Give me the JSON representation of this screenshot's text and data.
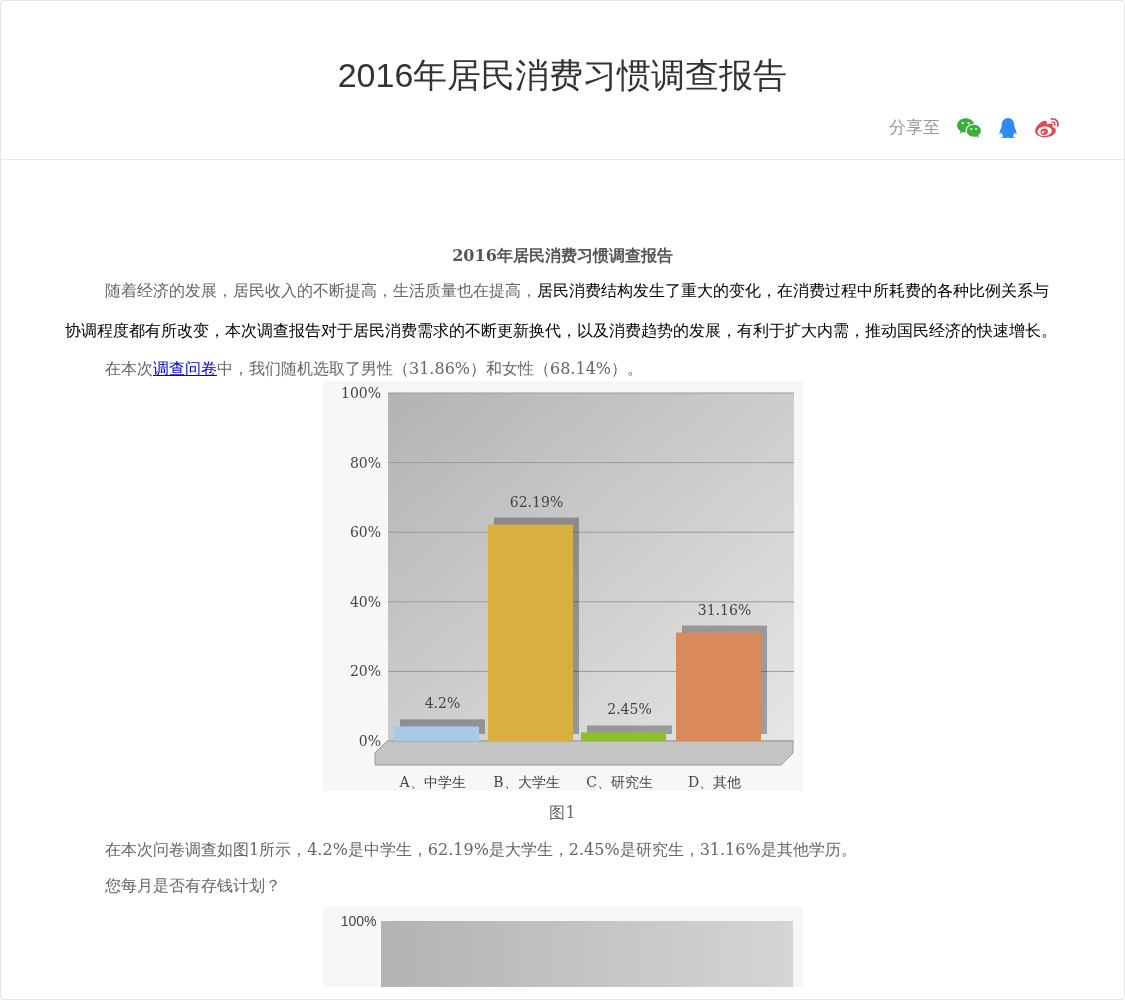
{
  "page_title": "2016年居民消费习惯调查报告",
  "share": {
    "label": "分享至",
    "icons": [
      {
        "kind": "wechat"
      },
      {
        "kind": "qq"
      },
      {
        "kind": "weibo"
      }
    ]
  },
  "article": {
    "heading": "2016年居民消费习惯调查报告",
    "intro": "随着经济的发展，居民收入的不断提高，生活质量也在提高，**居民消费结构发生了重大的变化，在消费过程中所耗费的各种比例关系与协调程度都有所改变，本次调查报告对于居民消费需求的不断更新换代，以及消费趋势的发展，有利于扩大内需，推动国民经济的快速增长。**",
    "sample_before": "在本次",
    "sample_link": "调查问卷",
    "sample_after": "中，我们随机选取了男性（31.86%）和女性（68.14%）。",
    "chart_data": {
      "type": "bar",
      "categories": [
        "A、中学生",
        "B、大学生",
        "C、研究生",
        "D、其他"
      ],
      "series": [
        {
          "values": [
            4.2,
            62.19,
            2.45,
            31.16
          ]
        }
      ],
      "grid": true,
      "colors": [
        "#a9c9e8",
        "#d9b040",
        "#8cbf2a",
        "#d9895a"
      ],
      "ylim": [
        0,
        100
      ],
      "yticks": [
        {
          "value": 0,
          "label": "0%"
        },
        {
          "value": 20,
          "label": "20%"
        },
        {
          "value": 40,
          "label": "40%"
        },
        {
          "value": 60,
          "label": "60%"
        },
        {
          "value": 80,
          "label": "80%"
        },
        {
          "value": 100,
          "label": "100%"
        }
      ],
      "value_labels": [
        "4.2%",
        "62.19%",
        "2.45%",
        "31.16%"
      ]
    },
    "caption": "图1",
    "summary": "在本次问卷调查如图1所示，4.2%是中学生，62.19%是大学生，2.45%是研究生，31.16%是其他学历。",
    "question": "您每月是否有存钱计划？",
    "next_chart_top_label": "100%"
  }
}
